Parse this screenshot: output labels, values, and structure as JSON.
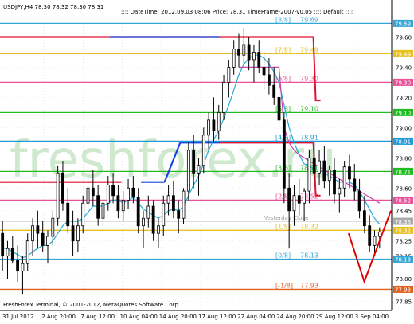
{
  "header": {
    "symbol_line": "USDJPY,H4  78.30 78.32 78.30 78.31",
    "info_line": ":::: DateTime: 2012.09.03 08:06   Price: 78.31   TimeFrame-2007-v0.05   :::: Default   ::::"
  },
  "watermark": "freshforex.ru",
  "footer": {
    "copyright": "FreshForex Terminal, © 2001-2012, MetaQuotes Software Corp."
  },
  "colors": {
    "background": "#ffffff",
    "candle": "#000000",
    "watermark": "#cfe9cf",
    "price_tag_text": "#ffffff",
    "forecast_arrow": "#e00000"
  },
  "chart_data": {
    "type": "candlestick",
    "symbol": "USDJPY",
    "timeframe": "H4",
    "ylim": [
      77.79,
      79.75
    ],
    "y_ticks": [
      79.6,
      79.4,
      79.2,
      79.0,
      78.8,
      78.6,
      78.45,
      78.25,
      78.15,
      78.0,
      77.85
    ],
    "price_tags": [
      {
        "value": 79.69,
        "label": "79.69",
        "color": "#33a6d8"
      },
      {
        "value": 79.49,
        "label": "79.49",
        "color": "#e8c020"
      },
      {
        "value": 79.3,
        "label": "79.30",
        "color": "#e8509a"
      },
      {
        "value": 79.1,
        "label": "79.10",
        "color": "#22bb22"
      },
      {
        "value": 78.91,
        "label": "78.91",
        "color": "#2299d8"
      },
      {
        "value": 78.71,
        "label": "78.71",
        "color": "#22bb22"
      },
      {
        "value": 78.52,
        "label": "78.52",
        "color": "#e8509a"
      },
      {
        "value": 78.38,
        "label": "78.38",
        "color": "#aaaaaa"
      },
      {
        "value": 78.32,
        "label": "78.32",
        "color": "#e8c020"
      },
      {
        "value": 78.13,
        "label": "78.13",
        "color": "#33a6d8"
      },
      {
        "value": 77.93,
        "label": "77.93",
        "color": "#e06020"
      }
    ],
    "x_labels": [
      "31 Jul 2012",
      "2 Aug 20:00",
      "7 Aug 12:00",
      "10 Aug 04:00",
      "14 Aug 20:00",
      "17 Aug 12:00",
      "22 Aug 04:00",
      "24 Aug 20:00",
      "29 Aug 12:00",
      "3 Sep 04:00"
    ],
    "murrey_levels": [
      {
        "label": "[8/8]",
        "value_label": "79.69",
        "value": 79.69,
        "color": "#33a6d8"
      },
      {
        "label": "[7/8]",
        "value_label": "79.49",
        "value": 79.49,
        "color": "#e8c020"
      },
      {
        "label": "[6/8]",
        "value_label": "79.30",
        "value": 79.3,
        "color": "#e8509a"
      },
      {
        "label": "[5/8]",
        "value_label": "79.10",
        "value": 79.1,
        "color": "#22bb22"
      },
      {
        "label": "[4/8]",
        "value_label": "78.91",
        "value": 78.91,
        "color": "#2299d8"
      },
      {
        "label": "[3/8]",
        "value_label": "78.71",
        "value": 78.71,
        "color": "#22bb22"
      },
      {
        "label": "[2/8]",
        "value_label": "78.52",
        "value": 78.52,
        "color": "#e8509a"
      },
      {
        "label": "[1/8]",
        "value_label": "78.32",
        "value": 78.32,
        "color": "#e8c020"
      },
      {
        "label": "[0/8]",
        "value_label": "78.13",
        "value": 78.13,
        "color": "#33a6d8"
      },
      {
        "label": "[-1/8]",
        "value_label": "77.93",
        "value": 77.93,
        "color": "#e06020"
      }
    ],
    "yesterday_close": {
      "label": "Yesterday Close",
      "value": 78.38,
      "color": "#bbbbbb"
    },
    "previous_levels": [
      {
        "value": 79.49,
        "color": "#e8c020"
      },
      {
        "value": 78.32,
        "color": "#e8c020"
      }
    ],
    "tf_lines": {
      "upper_red": [
        {
          "value": 79.6,
          "from": 0.0,
          "to": 0.8
        },
        {
          "value": 78.9,
          "from": 0.56,
          "to": 0.8
        }
      ],
      "lower_red": [
        {
          "value": 78.64,
          "from": 0.0,
          "to": 0.31
        }
      ],
      "blue_step": [
        {
          "value": 79.6,
          "from": 0.28,
          "to": 0.56
        },
        {
          "value": 78.64,
          "from": 0.36,
          "to": 0.42
        },
        {
          "value": 78.9,
          "from": 0.46,
          "to": 0.56
        }
      ]
    },
    "candles": [
      {
        "o": 78.3,
        "h": 78.38,
        "l": 78.05,
        "c": 78.15
      },
      {
        "o": 78.15,
        "h": 78.25,
        "l": 78.0,
        "c": 78.2
      },
      {
        "o": 78.2,
        "h": 78.28,
        "l": 78.1,
        "c": 78.12
      },
      {
        "o": 78.12,
        "h": 78.22,
        "l": 77.98,
        "c": 78.05
      },
      {
        "o": 78.05,
        "h": 78.15,
        "l": 77.9,
        "c": 78.1
      },
      {
        "o": 78.1,
        "h": 78.3,
        "l": 78.05,
        "c": 78.25
      },
      {
        "o": 78.25,
        "h": 78.4,
        "l": 78.15,
        "c": 78.35
      },
      {
        "o": 78.35,
        "h": 78.45,
        "l": 78.2,
        "c": 78.3
      },
      {
        "o": 78.3,
        "h": 78.38,
        "l": 78.18,
        "c": 78.22
      },
      {
        "o": 78.22,
        "h": 78.32,
        "l": 78.1,
        "c": 78.28
      },
      {
        "o": 78.28,
        "h": 78.45,
        "l": 78.22,
        "c": 78.4
      },
      {
        "o": 78.4,
        "h": 78.75,
        "l": 78.35,
        "c": 78.7
      },
      {
        "o": 78.7,
        "h": 78.78,
        "l": 78.45,
        "c": 78.5
      },
      {
        "o": 78.5,
        "h": 78.6,
        "l": 78.3,
        "c": 78.35
      },
      {
        "o": 78.35,
        "h": 78.45,
        "l": 78.15,
        "c": 78.25
      },
      {
        "o": 78.25,
        "h": 78.4,
        "l": 78.18,
        "c": 78.35
      },
      {
        "o": 78.35,
        "h": 78.55,
        "l": 78.3,
        "c": 78.5
      },
      {
        "o": 78.5,
        "h": 78.7,
        "l": 78.42,
        "c": 78.6
      },
      {
        "o": 78.6,
        "h": 78.72,
        "l": 78.48,
        "c": 78.55
      },
      {
        "o": 78.55,
        "h": 78.62,
        "l": 78.35,
        "c": 78.4
      },
      {
        "o": 78.4,
        "h": 78.55,
        "l": 78.32,
        "c": 78.5
      },
      {
        "o": 78.5,
        "h": 78.68,
        "l": 78.45,
        "c": 78.62
      },
      {
        "o": 78.62,
        "h": 78.7,
        "l": 78.5,
        "c": 78.55
      },
      {
        "o": 78.55,
        "h": 78.62,
        "l": 78.4,
        "c": 78.45
      },
      {
        "o": 78.45,
        "h": 78.58,
        "l": 78.38,
        "c": 78.52
      },
      {
        "o": 78.52,
        "h": 78.66,
        "l": 78.46,
        "c": 78.6
      },
      {
        "o": 78.6,
        "h": 78.68,
        "l": 78.5,
        "c": 78.54
      },
      {
        "o": 78.54,
        "h": 78.6,
        "l": 78.3,
        "c": 78.35
      },
      {
        "o": 78.35,
        "h": 78.45,
        "l": 78.2,
        "c": 78.4
      },
      {
        "o": 78.4,
        "h": 78.55,
        "l": 78.34,
        "c": 78.48
      },
      {
        "o": 78.48,
        "h": 78.52,
        "l": 78.25,
        "c": 78.3
      },
      {
        "o": 78.3,
        "h": 78.4,
        "l": 78.2,
        "c": 78.35
      },
      {
        "o": 78.35,
        "h": 78.55,
        "l": 78.28,
        "c": 78.5
      },
      {
        "o": 78.5,
        "h": 78.62,
        "l": 78.42,
        "c": 78.55
      },
      {
        "o": 78.55,
        "h": 78.65,
        "l": 78.4,
        "c": 78.45
      },
      {
        "o": 78.45,
        "h": 78.52,
        "l": 78.3,
        "c": 78.4
      },
      {
        "o": 78.4,
        "h": 78.6,
        "l": 78.36,
        "c": 78.58
      },
      {
        "o": 78.58,
        "h": 78.9,
        "l": 78.52,
        "c": 78.85
      },
      {
        "o": 78.85,
        "h": 78.95,
        "l": 78.6,
        "c": 78.7
      },
      {
        "o": 78.7,
        "h": 78.8,
        "l": 78.55,
        "c": 78.75
      },
      {
        "o": 78.75,
        "h": 79.0,
        "l": 78.7,
        "c": 78.95
      },
      {
        "o": 78.95,
        "h": 79.1,
        "l": 78.85,
        "c": 79.05
      },
      {
        "o": 79.05,
        "h": 79.2,
        "l": 78.9,
        "c": 78.98
      },
      {
        "o": 78.98,
        "h": 79.15,
        "l": 78.92,
        "c": 79.1
      },
      {
        "o": 79.1,
        "h": 79.35,
        "l": 79.05,
        "c": 79.3
      },
      {
        "o": 79.3,
        "h": 79.45,
        "l": 79.2,
        "c": 79.4
      },
      {
        "o": 79.4,
        "h": 79.58,
        "l": 79.35,
        "c": 79.52
      },
      {
        "o": 79.52,
        "h": 79.62,
        "l": 79.4,
        "c": 79.48
      },
      {
        "o": 79.48,
        "h": 79.66,
        "l": 79.42,
        "c": 79.55
      },
      {
        "o": 79.55,
        "h": 79.6,
        "l": 79.38,
        "c": 79.45
      },
      {
        "o": 79.45,
        "h": 79.55,
        "l": 79.3,
        "c": 79.5
      },
      {
        "o": 79.5,
        "h": 79.58,
        "l": 79.36,
        "c": 79.4
      },
      {
        "o": 79.4,
        "h": 79.5,
        "l": 79.25,
        "c": 79.35
      },
      {
        "o": 79.35,
        "h": 79.46,
        "l": 79.22,
        "c": 79.28
      },
      {
        "o": 79.28,
        "h": 79.4,
        "l": 79.15,
        "c": 79.2
      },
      {
        "o": 79.2,
        "h": 79.3,
        "l": 79.0,
        "c": 79.05
      },
      {
        "o": 79.05,
        "h": 79.1,
        "l": 78.5,
        "c": 78.6
      },
      {
        "o": 78.6,
        "h": 78.7,
        "l": 78.2,
        "c": 78.45
      },
      {
        "o": 78.45,
        "h": 78.62,
        "l": 78.35,
        "c": 78.55
      },
      {
        "o": 78.55,
        "h": 78.66,
        "l": 78.42,
        "c": 78.5
      },
      {
        "o": 78.5,
        "h": 78.6,
        "l": 78.38,
        "c": 78.58
      },
      {
        "o": 78.58,
        "h": 78.85,
        "l": 78.5,
        "c": 78.8
      },
      {
        "o": 78.8,
        "h": 78.9,
        "l": 78.65,
        "c": 78.7
      },
      {
        "o": 78.7,
        "h": 78.85,
        "l": 78.62,
        "c": 78.78
      },
      {
        "o": 78.78,
        "h": 78.88,
        "l": 78.6,
        "c": 78.65
      },
      {
        "o": 78.65,
        "h": 78.75,
        "l": 78.55,
        "c": 78.72
      },
      {
        "o": 78.72,
        "h": 78.8,
        "l": 78.5,
        "c": 78.56
      },
      {
        "o": 78.56,
        "h": 78.66,
        "l": 78.44,
        "c": 78.6
      },
      {
        "o": 78.6,
        "h": 78.78,
        "l": 78.54,
        "c": 78.74
      },
      {
        "o": 78.74,
        "h": 78.82,
        "l": 78.6,
        "c": 78.66
      },
      {
        "o": 78.66,
        "h": 78.76,
        "l": 78.52,
        "c": 78.58
      },
      {
        "o": 78.58,
        "h": 78.66,
        "l": 78.4,
        "c": 78.45
      },
      {
        "o": 78.45,
        "h": 78.55,
        "l": 78.3,
        "c": 78.35
      },
      {
        "o": 78.35,
        "h": 78.42,
        "l": 78.18,
        "c": 78.22
      },
      {
        "o": 78.22,
        "h": 78.32,
        "l": 78.15,
        "c": 78.28
      },
      {
        "o": 78.28,
        "h": 78.34,
        "l": 78.2,
        "c": 78.31
      }
    ],
    "ma_series": [
      {
        "name": "",
        "color": "#22aad8",
        "values": [
          78.2,
          78.2,
          78.18,
          78.16,
          78.14,
          78.15,
          78.18,
          78.2,
          78.22,
          78.22,
          78.25,
          78.3,
          78.35,
          78.38,
          78.38,
          78.38,
          78.4,
          78.44,
          78.48,
          78.48,
          78.48,
          78.5,
          78.52,
          78.52,
          78.5,
          78.52,
          78.54,
          78.5,
          78.46,
          78.44,
          78.42,
          78.4,
          78.42,
          78.45,
          78.46,
          78.45,
          78.48,
          78.55,
          78.62,
          78.68,
          78.76,
          78.85,
          78.92,
          78.98,
          79.06,
          79.15,
          79.25,
          79.35,
          79.42,
          79.46,
          79.48,
          79.48,
          79.46,
          79.42,
          79.37,
          79.3,
          79.15,
          79.0,
          78.9,
          78.82,
          78.76,
          78.75,
          78.72,
          78.72,
          78.7,
          78.68,
          78.66,
          78.64,
          78.64,
          78.64,
          78.62,
          78.58,
          78.52,
          78.46,
          78.4,
          78.36
        ]
      },
      {
        "name": "",
        "color": "#cc44aa",
        "values": [
          null,
          null,
          null,
          null,
          null,
          null,
          null,
          null,
          null,
          null,
          null,
          null,
          null,
          null,
          null,
          null,
          null,
          null,
          null,
          null,
          null,
          null,
          null,
          null,
          null,
          null,
          null,
          null,
          null,
          null,
          null,
          null,
          null,
          null,
          null,
          null,
          null,
          null,
          null,
          null,
          null,
          null,
          null,
          null,
          null,
          null,
          null,
          79.4,
          79.4,
          79.4,
          79.4,
          79.4,
          79.4,
          79.4,
          79.4,
          79.4,
          79.0,
          78.9,
          78.85,
          78.82,
          78.8,
          78.78,
          78.76,
          78.74,
          78.72,
          78.7,
          78.68,
          78.66,
          78.64,
          78.62,
          78.6,
          78.58,
          78.56,
          78.54,
          78.52,
          78.5
        ]
      }
    ],
    "forecast_path": [
      {
        "x_frac": 0.89,
        "y": 78.3
      },
      {
        "x_frac": 0.93,
        "y": 77.98
      },
      {
        "x_frac": 0.998,
        "y": 78.45
      }
    ]
  }
}
